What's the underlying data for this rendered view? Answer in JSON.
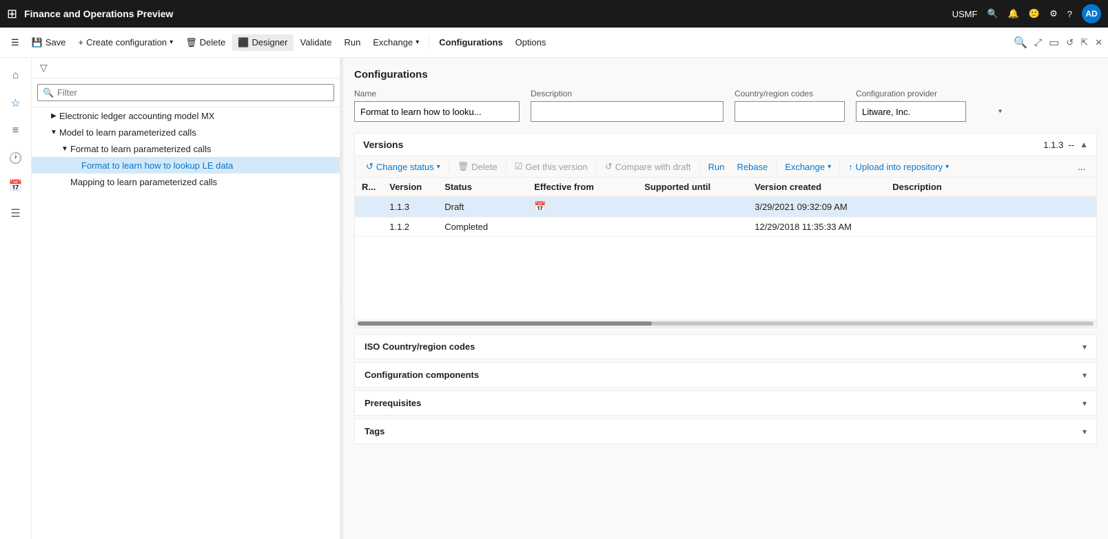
{
  "titleBar": {
    "appTitle": "Finance and Operations Preview",
    "userCode": "USMF",
    "userInitials": "AD"
  },
  "toolbar": {
    "saveLabel": "Save",
    "createConfigLabel": "Create configuration",
    "deleteLabel": "Delete",
    "designerLabel": "Designer",
    "validateLabel": "Validate",
    "runLabel": "Run",
    "exchangeLabel": "Exchange",
    "configurationsLabel": "Configurations",
    "optionsLabel": "Options"
  },
  "navPanel": {
    "filterPlaceholder": "Filter",
    "treeItems": [
      {
        "id": "item1",
        "label": "Electronic ledger accounting model MX",
        "indent": 1,
        "expanded": false,
        "toggle": "▶"
      },
      {
        "id": "item2",
        "label": "Model to learn parameterized calls",
        "indent": 1,
        "expanded": true,
        "toggle": "▼"
      },
      {
        "id": "item3",
        "label": "Format to learn parameterized calls",
        "indent": 2,
        "expanded": true,
        "toggle": "▼"
      },
      {
        "id": "item4",
        "label": "Format to learn how to lookup LE data",
        "indent": 3,
        "expanded": false,
        "toggle": "",
        "selected": true
      },
      {
        "id": "item5",
        "label": "Mapping to learn parameterized calls",
        "indent": 2,
        "expanded": false,
        "toggle": ""
      }
    ]
  },
  "mainContent": {
    "sectionTitle": "Configurations",
    "form": {
      "nameLabel": "Name",
      "nameValue": "Format to learn how to looku...",
      "descriptionLabel": "Description",
      "descriptionValue": "",
      "countryLabel": "Country/region codes",
      "countryValue": "",
      "providerLabel": "Configuration provider",
      "providerValue": "Litware, Inc."
    },
    "versions": {
      "title": "Versions",
      "badge": "1.1.3",
      "separator": "--",
      "toolbar": {
        "changeStatusLabel": "Change status",
        "deleteLabel": "Delete",
        "getThisVersionLabel": "Get this version",
        "compareWithDraftLabel": "Compare with draft",
        "runLabel": "Run",
        "rebaseLabel": "Rebase",
        "exchangeLabel": "Exchange",
        "uploadLabel": "Upload into repository",
        "moreLabel": "..."
      },
      "tableHeaders": [
        "R...",
        "Version",
        "Status",
        "Effective from",
        "Supported until",
        "Version created",
        "Description"
      ],
      "rows": [
        {
          "r": "",
          "version": "1.1.3",
          "status": "Draft",
          "effectiveFrom": "",
          "supportedUntil": "",
          "versionCreated": "3/29/2021 09:32:09 AM",
          "description": "",
          "selected": true
        },
        {
          "r": "",
          "version": "1.1.2",
          "status": "Completed",
          "effectiveFrom": "",
          "supportedUntil": "",
          "versionCreated": "12/29/2018 11:35:33 AM",
          "description": "",
          "selected": false
        }
      ]
    },
    "collapsibleSections": [
      {
        "id": "iso",
        "title": "ISO Country/region codes"
      },
      {
        "id": "components",
        "title": "Configuration components"
      },
      {
        "id": "prerequisites",
        "title": "Prerequisites"
      },
      {
        "id": "tags",
        "title": "Tags"
      }
    ]
  }
}
